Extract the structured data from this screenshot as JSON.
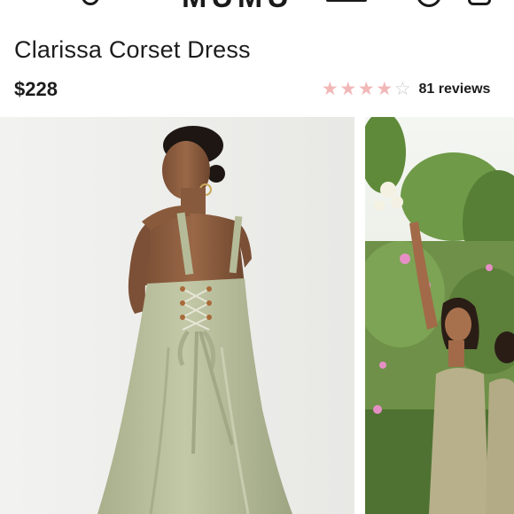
{
  "header": {
    "logo": "MUMU"
  },
  "product": {
    "title": "Clarissa Corset Dress",
    "price": "$228",
    "rating_value": 4,
    "rating_max": 5,
    "reviews_label": "81 reviews"
  },
  "colors": {
    "star_filled": "#f2b7b7",
    "star_empty": "#c9c9c9",
    "dress_sage": "#b5bb98"
  },
  "images": [
    {
      "name": "main-product-photo"
    },
    {
      "name": "second-product-photo"
    }
  ]
}
